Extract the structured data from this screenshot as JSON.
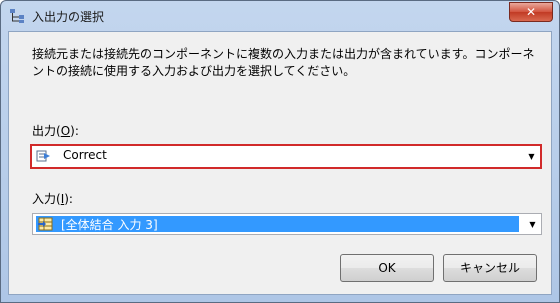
{
  "window": {
    "title": "入出力の選択",
    "close_glyph": "✕"
  },
  "description": "接続元または接続先のコンポーネントに複数の入力または出力が含まれています。コンポーネントの接続に使用する入力および出力を選択してください。",
  "output": {
    "label_prefix": "出力(",
    "label_key": "O",
    "label_suffix": "):",
    "value": "Correct"
  },
  "input": {
    "label_prefix": "入力(",
    "label_key": "I",
    "label_suffix": "):",
    "value": "[全体結合 入力 3]"
  },
  "buttons": {
    "ok": "OK",
    "cancel": "キャンセル"
  },
  "icons": {
    "app": "hierarchy-icon",
    "output": "output-arrow-icon",
    "input": "input-table-icon",
    "dropdown": "chevron-down-icon"
  },
  "colors": {
    "highlight_border": "#d12a2a",
    "selection": "#3399ff"
  }
}
